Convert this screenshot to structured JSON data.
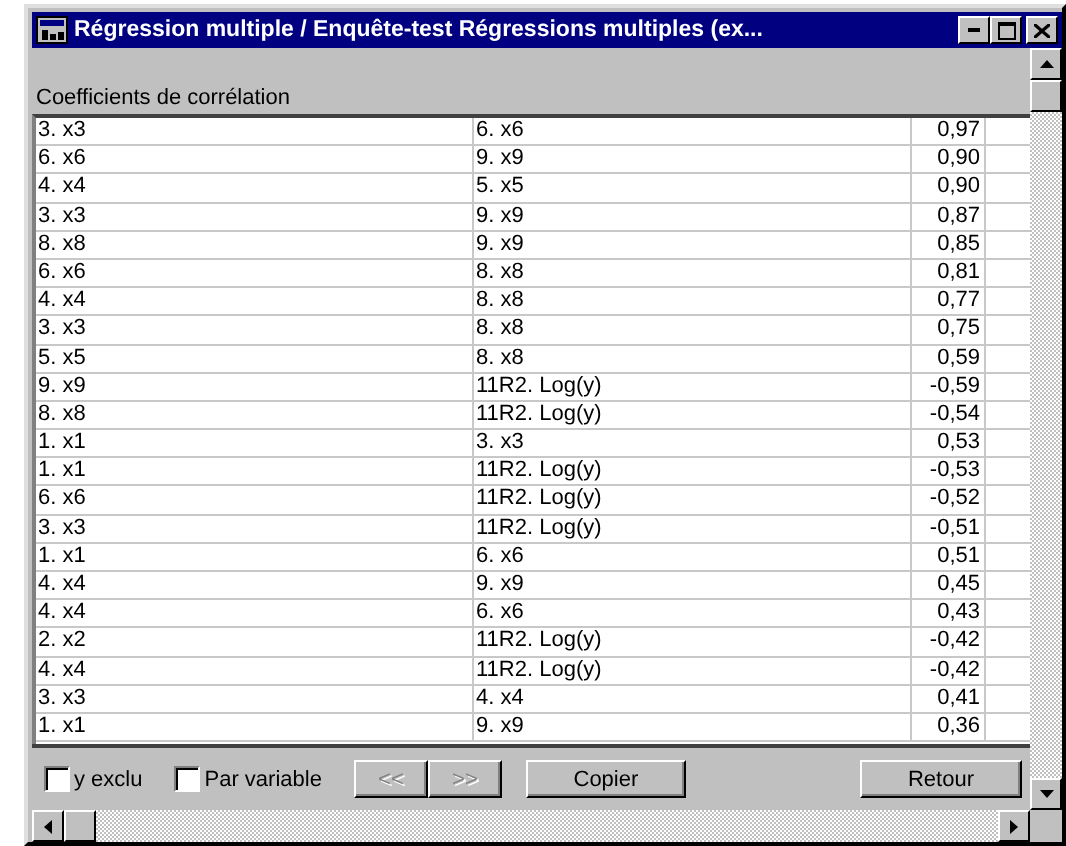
{
  "window": {
    "title": "Régression multiple / Enquête-test Régressions multiples (ex..."
  },
  "section_label": "Coefficients de corrélation",
  "table": {
    "rows": [
      [
        "3. x3",
        "6. x6",
        "0,97"
      ],
      [
        "6. x6",
        "9. x9",
        "0,90"
      ],
      [
        "4. x4",
        "5. x5",
        "0,90"
      ],
      [
        "3. x3",
        "9. x9",
        "0,87"
      ],
      [
        "8. x8",
        "9. x9",
        "0,85"
      ],
      [
        "6. x6",
        "8. x8",
        "0,81"
      ],
      [
        "4. x4",
        "8. x8",
        "0,77"
      ],
      [
        "3. x3",
        "8. x8",
        "0,75"
      ],
      [
        "5. x5",
        "8. x8",
        "0,59"
      ],
      [
        "9. x9",
        "11R2. Log(y)",
        "-0,59"
      ],
      [
        "8. x8",
        "11R2. Log(y)",
        "-0,54"
      ],
      [
        "1. x1",
        "3. x3",
        "0,53"
      ],
      [
        "1. x1",
        "11R2. Log(y)",
        "-0,53"
      ],
      [
        "6. x6",
        "11R2. Log(y)",
        "-0,52"
      ],
      [
        "3. x3",
        "11R2. Log(y)",
        "-0,51"
      ],
      [
        "1. x1",
        "6. x6",
        "0,51"
      ],
      [
        "4. x4",
        "9. x9",
        "0,45"
      ],
      [
        "4. x4",
        "6. x6",
        "0,43"
      ],
      [
        "2. x2",
        "11R2. Log(y)",
        "-0,42"
      ],
      [
        "4. x4",
        "11R2. Log(y)",
        "-0,42"
      ],
      [
        "3. x3",
        "4. x4",
        "0,41"
      ],
      [
        "1. x1",
        "9. x9",
        "0,36"
      ]
    ]
  },
  "checkboxes": [
    {
      "label": "y exclu",
      "checked": false
    },
    {
      "label": "Par variable",
      "checked": false
    }
  ],
  "nav_buttons": [
    {
      "label": "<<",
      "disabled": true
    },
    {
      "label": ">>",
      "disabled": true
    }
  ],
  "buttons": [
    {
      "label": "Copier"
    },
    {
      "label": "Retour"
    }
  ]
}
